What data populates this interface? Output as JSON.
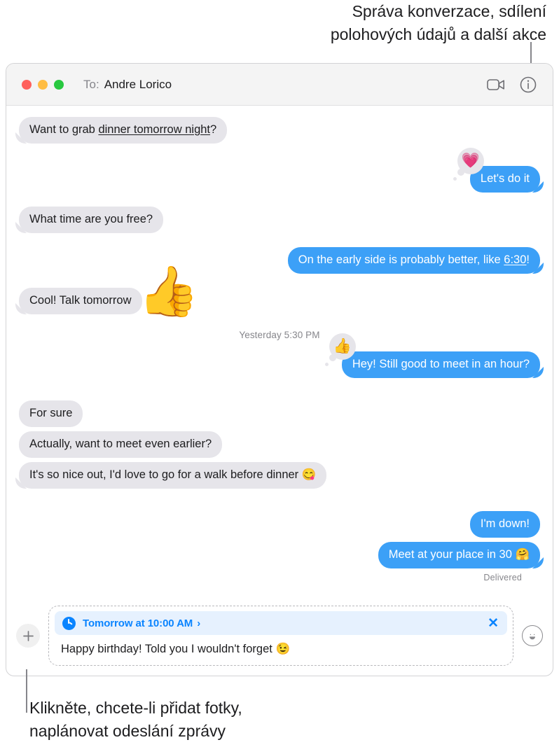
{
  "callouts": {
    "top": "Správa konverzace, sdílení\npolohových údajů a další akce",
    "bottom": "Klikněte, chcete-li přidat fotky,\nnaplánovat odeslání zprávy"
  },
  "window": {
    "titlebar": {
      "to_label": "To:",
      "recipient": "Andre Lorico",
      "facetime_icon": "video-camera-icon",
      "info_icon": "info-circle-icon"
    }
  },
  "conversation": {
    "timestamp": "Yesterday 5:30 PM",
    "delivered_status": "Delivered",
    "messages": [
      {
        "id": "m1",
        "side": "left",
        "text_before": "Want to grab ",
        "link": "dinner tomorrow night",
        "text_after": "?",
        "reaction": "",
        "sticker": ""
      },
      {
        "id": "m2",
        "side": "right",
        "text": "Let's do it",
        "reaction": "💗"
      },
      {
        "id": "m3",
        "side": "left",
        "text": "What time are you free?"
      },
      {
        "id": "m4",
        "side": "right",
        "text_before": "On the early side is probably better, like ",
        "link": "6:30",
        "text_after": "!"
      },
      {
        "id": "m5",
        "side": "left",
        "text": "Cool! Talk tomorrow",
        "sticker": "👍"
      },
      {
        "id": "m6",
        "side": "right",
        "text": "Hey! Still good to meet in an hour?",
        "reaction": "👍"
      },
      {
        "id": "m7",
        "side": "left",
        "text": "For sure"
      },
      {
        "id": "m8",
        "side": "left",
        "text": "Actually, want to meet even earlier?"
      },
      {
        "id": "m9",
        "side": "left",
        "text": "It's so nice out, I'd love to go for a walk before dinner 😋"
      },
      {
        "id": "m10",
        "side": "right",
        "text": "I'm down!"
      },
      {
        "id": "m11",
        "side": "right",
        "text": "Meet at your place in 30 🤗"
      }
    ]
  },
  "compose": {
    "add_button_label": "+",
    "add_button_icon": "plus-icon",
    "emoji_button_icon": "smiley-face-icon",
    "schedule": {
      "clock_icon": "clock-icon",
      "label": "Tomorrow at 10:00 AM",
      "chevron": "›",
      "close_label": "✕"
    },
    "message_text": "Happy birthday! Told you I wouldn't forget 😉"
  },
  "colors": {
    "bubble_blue": "#3ca0f7",
    "bubble_grey": "#e6e5ea",
    "accent_blue": "#0a84ff",
    "banner_bg": "#e6f1fe"
  }
}
